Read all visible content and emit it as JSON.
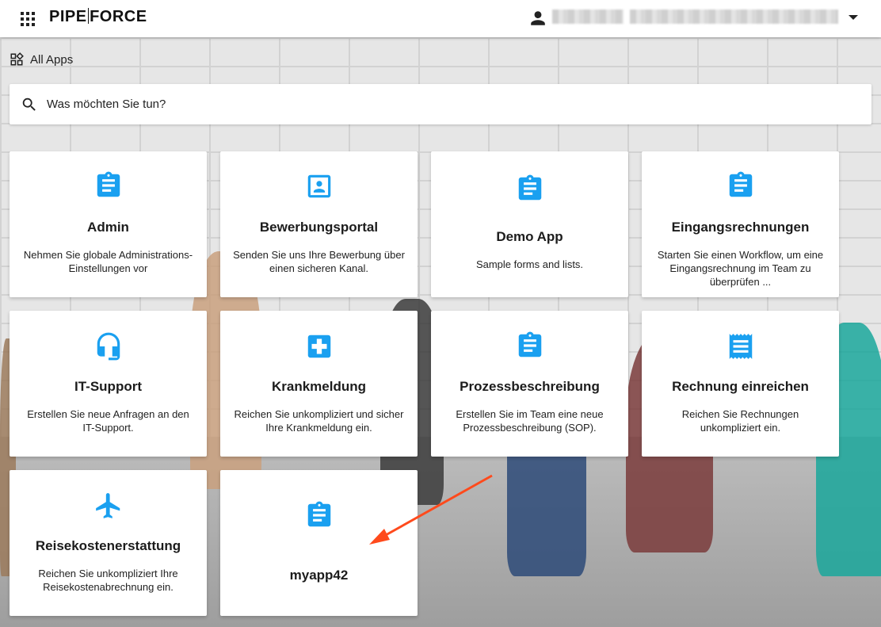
{
  "brand": {
    "left": "PIPE",
    "right": "FORCE"
  },
  "header": {
    "user_name": "",
    "accent": "#1aa0f0"
  },
  "section": {
    "label": "All Apps"
  },
  "search": {
    "placeholder": "Was möchten Sie tun?"
  },
  "apps": [
    {
      "title": "Admin",
      "description": "Nehmen Sie globale Administrations-Einstellungen vor",
      "icon": "clipboard-icon"
    },
    {
      "title": "Bewerbungsportal",
      "description": "Senden Sie uns Ihre Bewerbung über einen sicheren Kanal.",
      "icon": "portrait-icon"
    },
    {
      "title": "Demo App",
      "description": "Sample forms and lists.",
      "icon": "clipboard-icon"
    },
    {
      "title": "Eingangsrechnungen",
      "description": "Starten Sie einen Workflow, um eine Eingangsrechnung im Team zu überprüfen ...",
      "icon": "clipboard-icon"
    },
    {
      "title": "IT-Support",
      "description": "Erstellen Sie neue Anfragen an den IT-Support.",
      "icon": "headset-icon"
    },
    {
      "title": "Krankmeldung",
      "description": "Reichen Sie unkompliziert und sicher Ihre Krankmeldung ein.",
      "icon": "medical-cross-icon"
    },
    {
      "title": "Prozessbeschreibung",
      "description": "Erstellen Sie im Team eine neue Prozessbeschreibung (SOP).",
      "icon": "clipboard-icon"
    },
    {
      "title": "Rechnung einreichen",
      "description": "Reichen Sie Rechnungen unkompliziert ein.",
      "icon": "receipt-icon"
    },
    {
      "title": "Reisekostenerstattung",
      "description": "Reichen Sie unkompliziert Ihre Reisekostenabrechnung ein.",
      "icon": "airplane-icon"
    },
    {
      "title": "myapp42",
      "description": "",
      "icon": "clipboard-icon"
    }
  ]
}
